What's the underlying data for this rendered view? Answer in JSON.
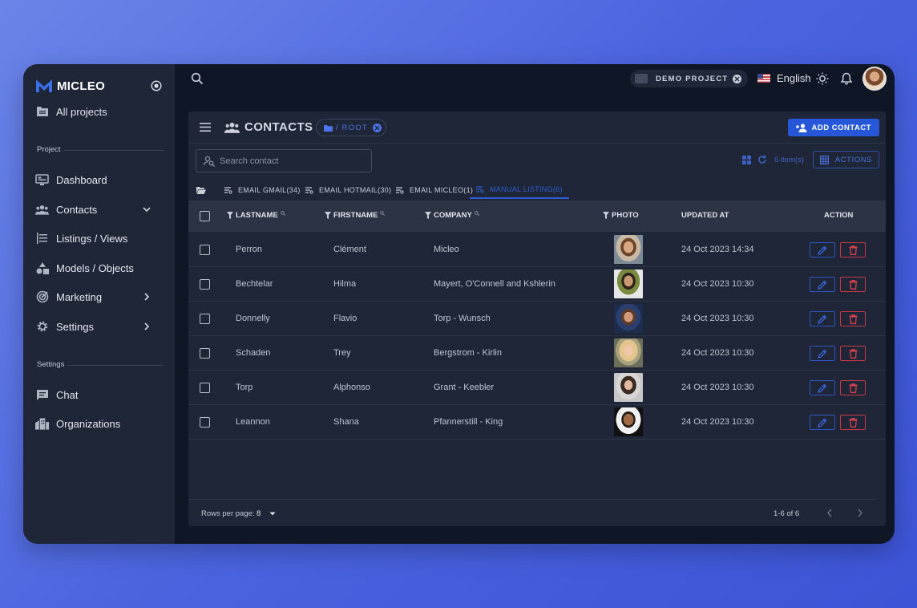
{
  "brand": {
    "name": "MICLEO"
  },
  "sidebar": {
    "all_projects": "All projects",
    "section_project": "Project",
    "items": [
      {
        "label": "Dashboard",
        "icon": "dashboard-icon"
      },
      {
        "label": "Contacts",
        "icon": "people-icon",
        "chevron": "down"
      },
      {
        "label": "Listings / Views",
        "icon": "list-icon"
      },
      {
        "label": "Models / Objects",
        "icon": "shapes-icon"
      },
      {
        "label": "Marketing",
        "icon": "target-icon",
        "chevron": "right"
      },
      {
        "label": "Settings",
        "icon": "gear-icon",
        "chevron": "right"
      }
    ],
    "section_settings": "Settings",
    "settings_items": [
      {
        "label": "Chat",
        "icon": "chat-icon"
      },
      {
        "label": "Organizations",
        "icon": "building-icon"
      }
    ]
  },
  "topbar": {
    "project": "DEMO PROJECT",
    "language": "English"
  },
  "card": {
    "title": "CONTACTS",
    "root_chip": "/ ROOT",
    "add_button": "ADD CONTACT",
    "search_placeholder": "Search contact",
    "items_count": "6 item(s)",
    "actions_button": "ACTIONS",
    "tabs": [
      {
        "label": "EMAIL GMAIL(34)"
      },
      {
        "label": "EMAIL HOTMAIL(30)"
      },
      {
        "label": "EMAIL MICLEO(1)"
      },
      {
        "label": "MANUAL LISTING(6)",
        "active": true
      }
    ],
    "columns": {
      "lastname": "LASTNAME",
      "firstname": "FIRSTNAME",
      "company": "COMPANY",
      "photo": "PHOTO",
      "updated_at": "UPDATED AT",
      "action": "ACTION"
    },
    "rows": [
      {
        "lastname": "Perron",
        "firstname": "Clément",
        "company": "Micleo",
        "updated": "24 Oct 2023 14:34"
      },
      {
        "lastname": "Bechtelar",
        "firstname": "Hilma",
        "company": "Mayert, O'Connell and Kshlerin",
        "updated": "24 Oct 2023 10:30"
      },
      {
        "lastname": "Donnelly",
        "firstname": "Flavio",
        "company": "Torp - Wunsch",
        "updated": "24 Oct 2023 10:30"
      },
      {
        "lastname": "Schaden",
        "firstname": "Trey",
        "company": "Bergstrom - Kirlin",
        "updated": "24 Oct 2023 10:30"
      },
      {
        "lastname": "Torp",
        "firstname": "Alphonso",
        "company": "Grant - Keebler",
        "updated": "24 Oct 2023 10:30"
      },
      {
        "lastname": "Leannon",
        "firstname": "Shana",
        "company": "Pfannerstill - King",
        "updated": "24 Oct 2023 10:30"
      }
    ],
    "footer": {
      "rows_per_page_label": "Rows per page:",
      "rows_per_page_value": "8",
      "range": "1-6 of 6"
    }
  },
  "colors": {
    "accent": "#2657d9",
    "danger": "#c93744",
    "sidebar_bg": "#1e2637",
    "app_bg": "#0f1626"
  }
}
